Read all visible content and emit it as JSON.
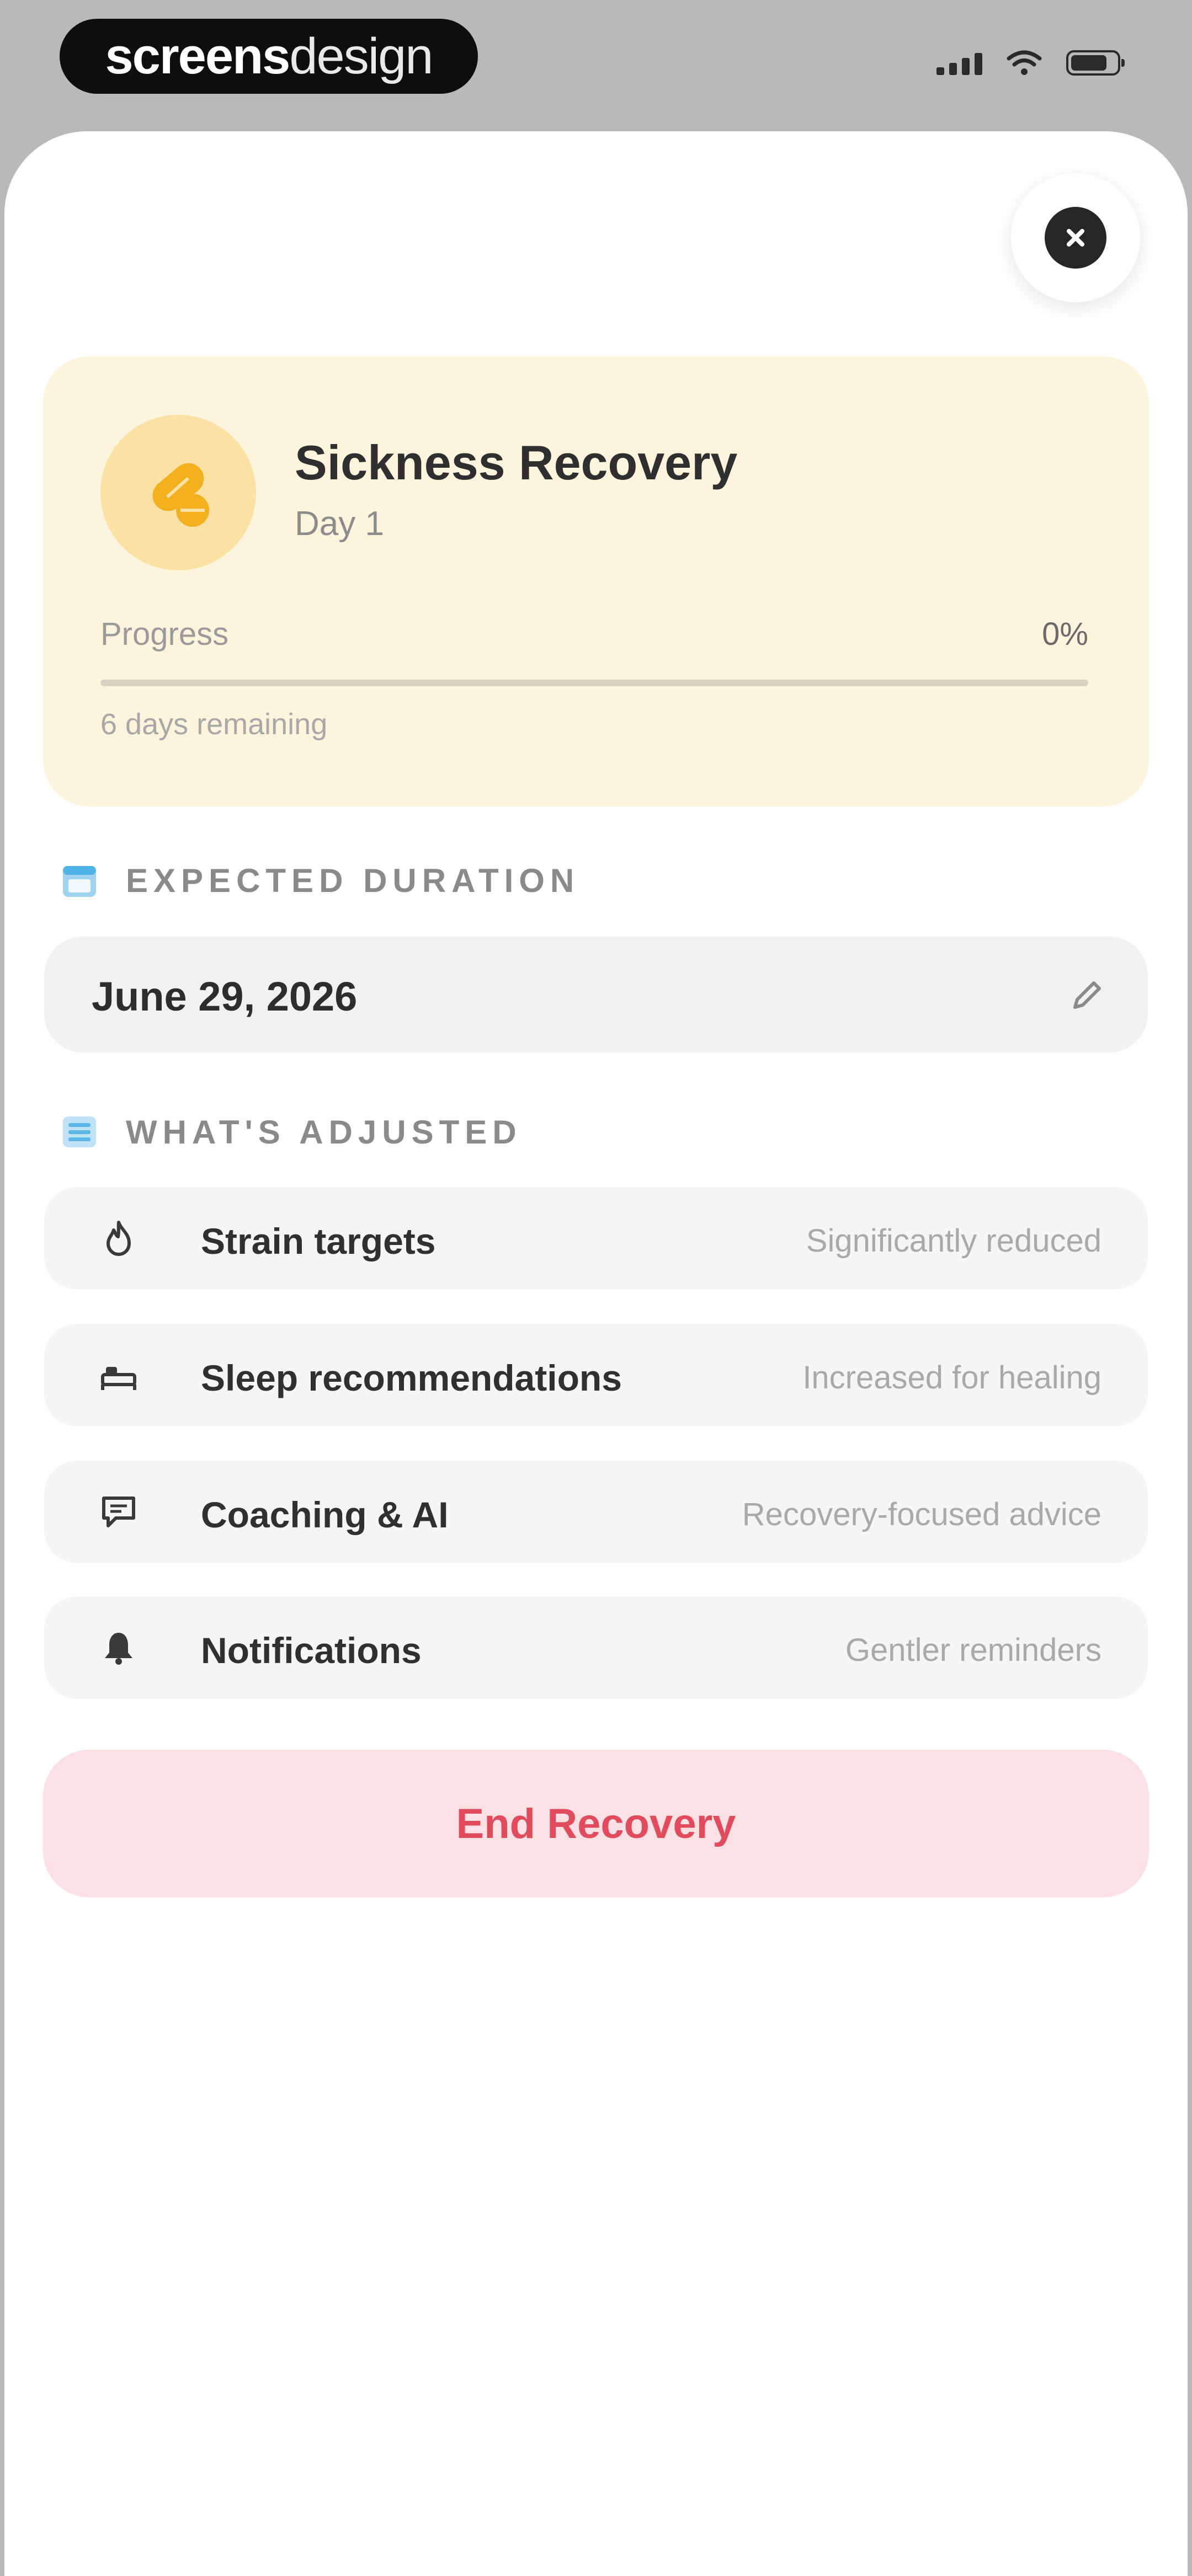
{
  "status_bar": {
    "brand_bold": "screens",
    "brand_light": "design"
  },
  "close": {
    "icon": "close-icon"
  },
  "recovery": {
    "title": "Sickness Recovery",
    "day": "Day 1",
    "progress_label": "Progress",
    "progress_value": "0%",
    "progress_fraction": 0,
    "remaining": "6 days remaining",
    "accent": "#f2b01e"
  },
  "duration": {
    "header": "EXPECTED DURATION",
    "date": "June 29, 2026"
  },
  "adjusted": {
    "header": "WHAT'S ADJUSTED",
    "items": [
      {
        "icon": "flame-icon",
        "label": "Strain targets",
        "value": "Significantly reduced"
      },
      {
        "icon": "bed-icon",
        "label": "Sleep recommendations",
        "value": "Increased for healing"
      },
      {
        "icon": "chat-icon",
        "label": "Coaching & AI",
        "value": "Recovery-focused advice"
      },
      {
        "icon": "bell-icon",
        "label": "Notifications",
        "value": "Gentler reminders"
      }
    ]
  },
  "actions": {
    "end_label": "End Recovery",
    "end_color": "#e04b5e"
  }
}
